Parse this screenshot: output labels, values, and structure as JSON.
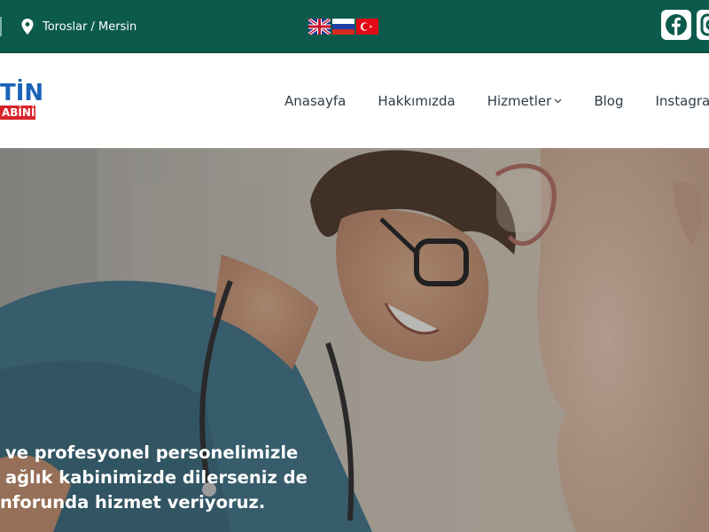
{
  "topbar": {
    "location": "Toroslar / Mersin",
    "flags": [
      "flag-uk-icon",
      "flag-russia-icon",
      "flag-turkey-icon"
    ],
    "social": [
      "facebook-icon",
      "instagram-icon"
    ],
    "background": "#0b5a4b"
  },
  "logo": {
    "top_text": "TİN",
    "bottom_text": "ABİNİ",
    "colors": {
      "top": "#1a63b8",
      "bottom_bg": "#d8232a"
    }
  },
  "nav": {
    "items": [
      {
        "label": "Anasayfa"
      },
      {
        "label": "Hakkımızda"
      },
      {
        "label": "Hizmetler",
        "has_dropdown": true
      },
      {
        "label": "Blog"
      },
      {
        "label": "Instagram"
      }
    ]
  },
  "hero": {
    "lines": [
      "ve profesyonel personelimizle",
      "ağlık kabinimizde dilerseniz de",
      "nforunda hizmet veriyoruz."
    ]
  }
}
